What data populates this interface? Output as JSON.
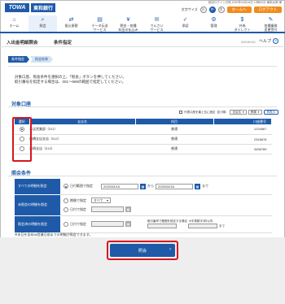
{
  "header": {
    "logo_text": "TOWA",
    "logo_bank": "東和銀行",
    "meta": "前回ログイン日時 2020年04月16日 10時00分 東和太郎 様",
    "font_size_label": "文字サイズ",
    "font_sizes": [
      "小",
      "中",
      "大"
    ],
    "home_label": "ホームへ",
    "logout_label": "ログアウト"
  },
  "nav": [
    {
      "label": "ホーム",
      "icon": "home-icon"
    },
    {
      "label": "照会",
      "icon": "search-icon",
      "active": true
    },
    {
      "label": "振込振替",
      "icon": "transfer-icon"
    },
    {
      "label": "データ伝送\nサービス",
      "icon": "data-icon"
    },
    {
      "label": "税金・各種\n料金の払込み",
      "icon": "tax-icon"
    },
    {
      "label": "でんさい\nサービス",
      "icon": "densai-icon"
    },
    {
      "label": "承認",
      "icon": "approve-icon"
    },
    {
      "label": "管理",
      "icon": "gear-icon"
    },
    {
      "label": "外為\nダイレクト",
      "icon": "forex-icon"
    },
    {
      "label": "各種業務\n変更受付",
      "icon": "change-icon"
    }
  ],
  "title": {
    "main": "入出金明細照会",
    "sub": "条件指定",
    "code": "BZMK001",
    "help": "ヘルプ"
  },
  "steps": [
    "条件指定",
    "照会結果"
  ],
  "instructions": [
    "対象口座、照会条件を選択の上、「照会」ボタンを押してください。",
    "取引番号を指定する場合は、001～999の範囲で指定してください。"
  ],
  "accounts": {
    "heading": "対象口座",
    "toolbar": {
      "rep_label": "代表口座を最上位に固定",
      "sort_label": "並び順：",
      "sort_key": "支店名",
      "sort_order": "昇順",
      "sort_button": "再表示"
    },
    "columns": [
      "選択",
      "支店名",
      "科目",
      "口座番号"
    ],
    "rows": [
      {
        "branch": "本店営業部（011）",
        "type": "普通",
        "number": "1234567",
        "selected": true
      },
      {
        "branch": "前橋支店支店（012）",
        "type": "普通",
        "number": "2345678",
        "selected": false
      },
      {
        "branch": "高崎支店（013）",
        "type": "普通",
        "number": "3456789",
        "selected": false
      }
    ]
  },
  "conditions": {
    "heading": "照会条件",
    "rows": [
      {
        "label": "すべての明細を照会",
        "option": "日付範囲で指定",
        "from": "2020/04/16",
        "to": "2020/04/16",
        "sep": "から",
        "suffix": "まで"
      },
      {
        "label": "未照会の明細を照会",
        "option1": "期間で指定",
        "period": "すべて",
        "option2": "日付で指定"
      },
      {
        "label": "照会済の明細を照会",
        "option": "日付で指定",
        "ref_label": "取引番号で範囲を指定する場合",
        "ref_hint": "※半角数字3桁以内",
        "ref_suffix": "まで"
      }
    ],
    "note": "※本日を含め66営業日前までの明細が照会できます。"
  },
  "submit_label": "照会",
  "colors": {
    "primary": "#1e5aa8",
    "accent": "#f08c1e",
    "highlight": "#d8141e"
  }
}
